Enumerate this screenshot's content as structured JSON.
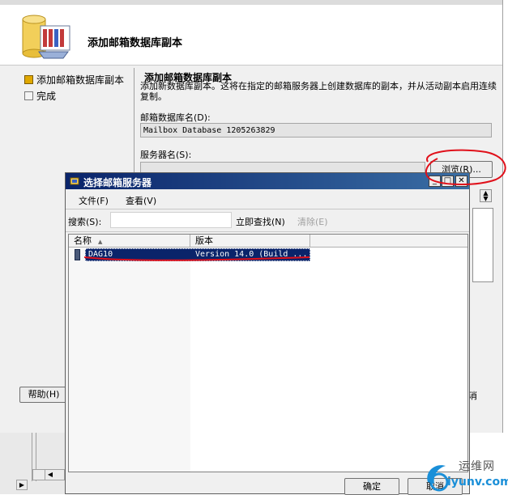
{
  "wizard": {
    "title": "添加邮箱数据库副本",
    "steps": [
      {
        "label": "添加邮箱数据库副本",
        "active": true
      },
      {
        "label": "完成",
        "active": false
      }
    ],
    "page_title": "添加邮箱数据库副本",
    "description": "添加新数据库副本。这将在指定的邮箱服务器上创建数据库的副本，并从活动副本启用连续复制。",
    "db_name_label": "邮箱数据库名(D):",
    "db_name_value": "Mailbox Database 1205263829",
    "server_label": "服务器名(S):",
    "server_value": "",
    "browse_label": "浏览(R)...",
    "help_label": "帮助(H)",
    "cancel_partial": "消"
  },
  "dialog": {
    "title": "选择邮箱服务器",
    "menu": [
      "文件(F)",
      "查看(V)"
    ],
    "search_label": "搜索(S):",
    "search_value": "",
    "find_now": "立即查找(N)",
    "clear": "清除(E)",
    "columns": [
      "名称",
      "版本"
    ],
    "rows": [
      {
        "name": "DAG10",
        "version": "Version 14.0 (Build ...",
        "selected": true
      }
    ],
    "ok_label": "确定",
    "cancel_label": "取消"
  },
  "watermark": {
    "brand": "运维网",
    "url": "iyunv.com"
  },
  "colors": {
    "titlebar": "#0a246a",
    "selection": "#0a246a",
    "annotation": "#e0101a",
    "step_active": "#e0a800"
  },
  "icons": [
    "database-wizard-icon",
    "dialog-app-icon",
    "server-row-icon",
    "minimize-icon",
    "maximize-icon",
    "close-icon",
    "sort-ascending-icon"
  ]
}
